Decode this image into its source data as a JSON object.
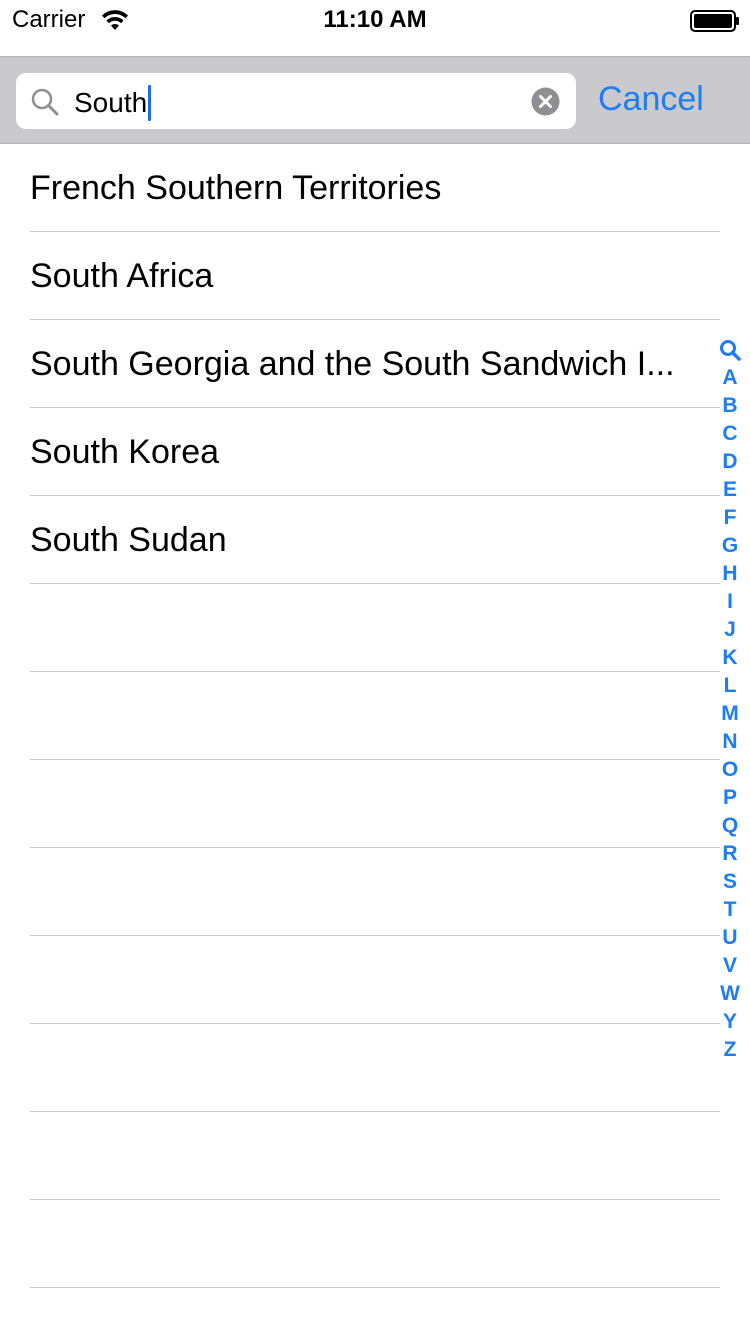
{
  "status_bar": {
    "carrier": "Carrier",
    "time": "11:10 AM",
    "icons": [
      "wifi-icon",
      "battery-icon"
    ]
  },
  "search": {
    "value": "South",
    "cancel_label": "Cancel",
    "icons": [
      "search-icon",
      "clear-icon"
    ]
  },
  "results": [
    "French Southern Territories",
    "South Africa",
    "South Georgia and the South Sandwich I...",
    "South Korea",
    "South Sudan"
  ],
  "index": [
    "A",
    "B",
    "C",
    "D",
    "E",
    "F",
    "G",
    "H",
    "I",
    "J",
    "K",
    "L",
    "M",
    "N",
    "O",
    "P",
    "Q",
    "R",
    "S",
    "T",
    "U",
    "V",
    "W",
    "Y",
    "Z"
  ],
  "colors": {
    "accent": "#1e7df2",
    "search_bar_bg": "#c9c9ce",
    "separator": "#c8c7cc",
    "caret": "#1e6cf3"
  }
}
